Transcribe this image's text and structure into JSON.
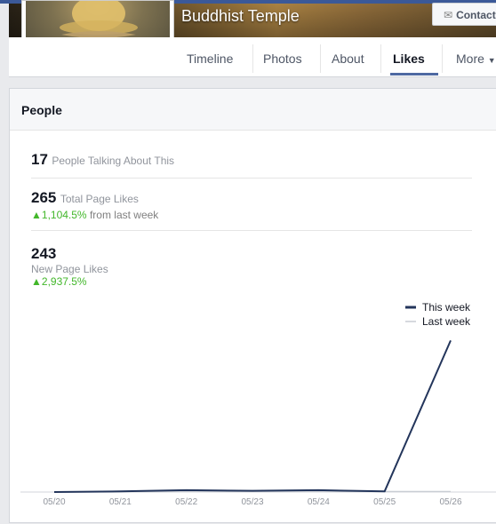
{
  "header": {
    "page_name": "Buddhist Temple",
    "contact_label": "Contact"
  },
  "nav": {
    "tabs": [
      {
        "label": "Timeline",
        "active": false
      },
      {
        "label": "Photos",
        "active": false
      },
      {
        "label": "About",
        "active": false
      },
      {
        "label": "Likes",
        "active": true
      },
      {
        "label": "More",
        "active": false
      }
    ]
  },
  "people": {
    "title": "People",
    "talking": {
      "value": "17",
      "label": "People Talking About This"
    },
    "total_likes": {
      "value": "265",
      "label": "Total Page Likes",
      "delta": "1,104.5%",
      "delta_suffix": "from last week"
    },
    "new_likes": {
      "value": "243",
      "label": "New Page Likes",
      "delta": "2,937.5%"
    }
  },
  "colors": {
    "this_week": "#23355b",
    "last_week": "#c8ccd2",
    "growth": "#42b72a"
  },
  "chart_data": {
    "type": "line",
    "categories": [
      "05/20",
      "05/21",
      "05/22",
      "05/23",
      "05/24",
      "05/25",
      "05/26"
    ],
    "series": [
      {
        "name": "This week",
        "values": [
          0,
          1,
          3,
          2,
          3,
          1,
          243
        ]
      },
      {
        "name": "Last week",
        "values": [
          0,
          0,
          1,
          1,
          1,
          1,
          1
        ]
      }
    ],
    "ylim": [
      0,
      245
    ],
    "legend_position": "top-right",
    "grid": false
  }
}
